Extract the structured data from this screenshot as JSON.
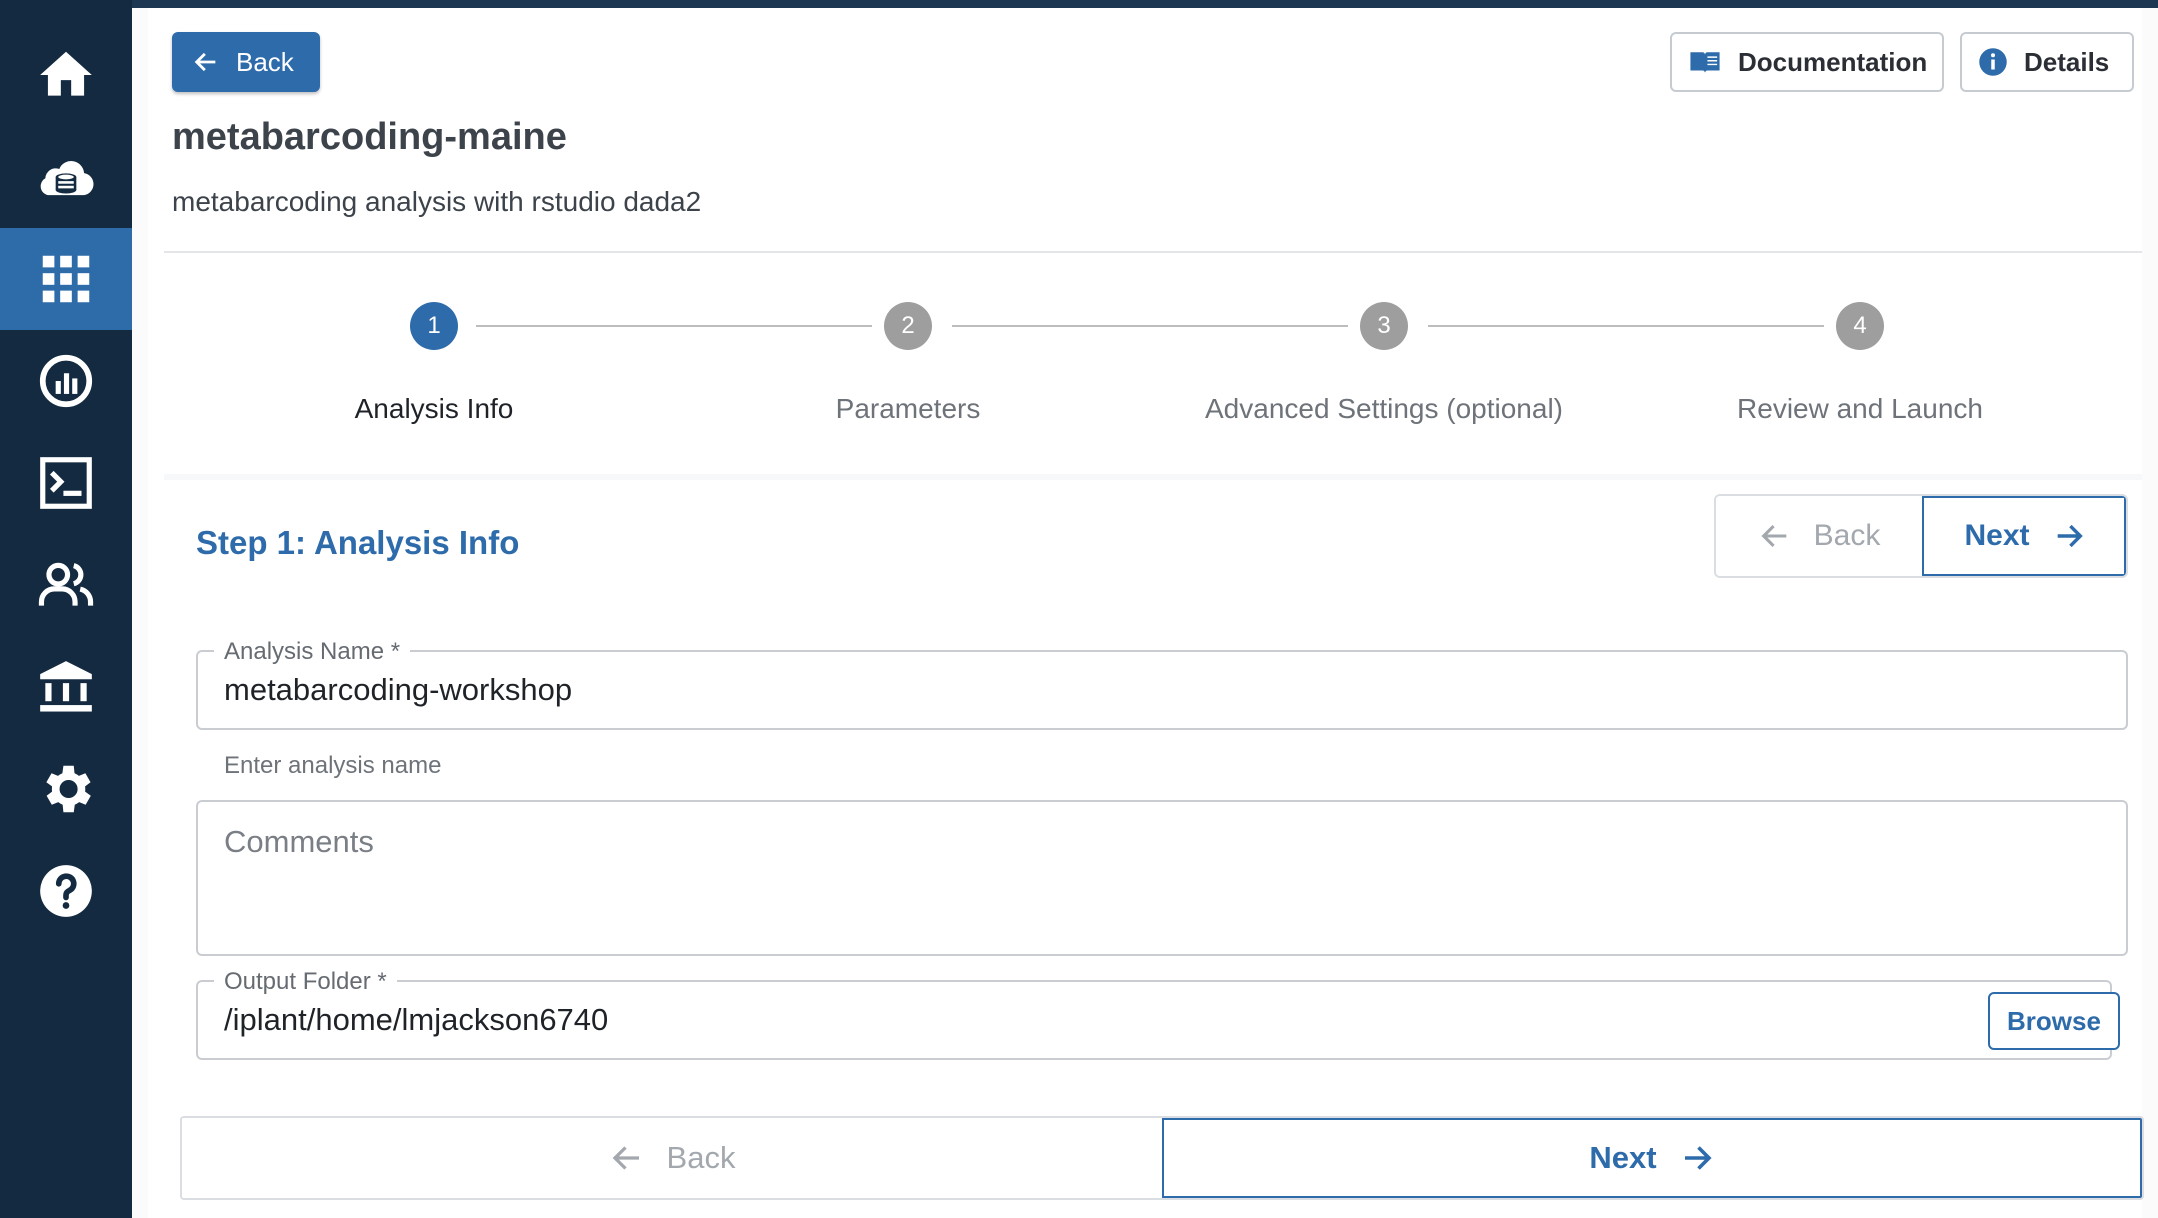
{
  "header": {
    "back_label": "Back",
    "documentation_label": "Documentation",
    "details_label": "Details",
    "title": "metabarcoding-maine",
    "subtitle": "metabarcoding analysis with rstudio dada2"
  },
  "sidenav": {
    "items": [
      {
        "icon": "home-icon"
      },
      {
        "icon": "cloud-data-icon"
      },
      {
        "icon": "apps-grid-icon",
        "active": true
      },
      {
        "icon": "analyses-icon"
      },
      {
        "icon": "terminal-icon"
      },
      {
        "icon": "teams-icon"
      },
      {
        "icon": "institution-icon"
      },
      {
        "icon": "settings-icon"
      },
      {
        "icon": "help-icon"
      }
    ]
  },
  "stepper": {
    "steps": [
      {
        "number": "1",
        "label": "Analysis Info",
        "active": true
      },
      {
        "number": "2",
        "label": "Parameters"
      },
      {
        "number": "3",
        "label": "Advanced Settings (optional)"
      },
      {
        "number": "4",
        "label": "Review and Launch"
      }
    ]
  },
  "step_heading": "Step 1: Analysis Info",
  "nav_buttons": {
    "back_label": "Back",
    "next_label": "Next"
  },
  "form": {
    "analysis_name": {
      "label": "Analysis Name *",
      "value": "metabarcoding-workshop",
      "helper": "Enter analysis name"
    },
    "comments": {
      "placeholder": "Comments"
    },
    "output_folder": {
      "label": "Output Folder *",
      "value": "/iplant/home/lmjackson6740",
      "browse_label": "Browse"
    }
  },
  "colors": {
    "primary": "#2e6bab",
    "sidebar": "#142a40",
    "sidebar_active": "#2d6ba9"
  }
}
